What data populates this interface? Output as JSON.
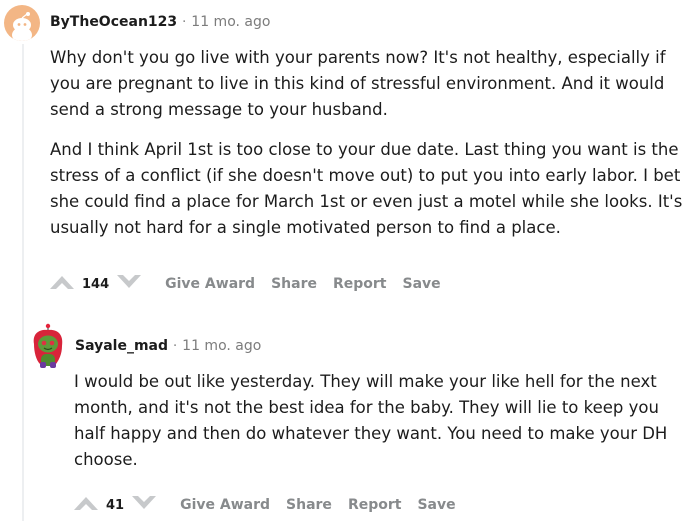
{
  "comments": [
    {
      "username": "ByTheOcean123",
      "separator": "·",
      "time": "11 mo. ago",
      "paragraphs": [
        "Why don't you go live with your parents now? It's not healthy, especially if you are pregnant to live in this kind of stressful environment. And it would send a strong message to your husband.",
        "And I think April 1st is too close to your due date. Last thing you want is the stress of a conflict (if she doesn't move out) to put you into early labor. I bet she could find a place for March 1st or even just a motel while she looks. It's usually not hard for a single motivated person to find a place."
      ],
      "score": "144",
      "actions": {
        "give_award": "Give Award",
        "share": "Share",
        "report": "Report",
        "save": "Save"
      }
    },
    {
      "username": "Sayale_mad",
      "separator": "·",
      "time": "11 mo. ago",
      "paragraphs": [
        "I would be out like yesterday. They will make your like hell for the next month, and it's not the best idea for the baby. They will lie to keep you half happy and then do whatever they want. You need to make your DH choose."
      ],
      "score": "41",
      "actions": {
        "give_award": "Give Award",
        "share": "Share",
        "report": "Report",
        "save": "Save"
      }
    }
  ],
  "colors": {
    "meta": "#7c7c7c",
    "action": "#878a8c",
    "vote_icon": "#c7c9cb",
    "thread": "#edeff1"
  },
  "icons": [
    "avatar-snoo-icon",
    "upvote-icon",
    "downvote-icon"
  ]
}
